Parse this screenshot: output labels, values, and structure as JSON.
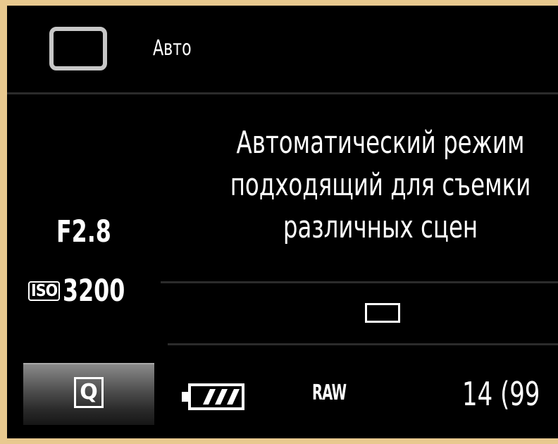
{
  "mode": {
    "icon": "square-mode-icon",
    "label": "Авто"
  },
  "description": {
    "line1": "Автоматический режим",
    "line2": "подходящий для съемки",
    "line3": "различных сцен"
  },
  "exposure": {
    "aperture": "F2.8",
    "iso_icon_text": "ISO",
    "iso_value": "3200"
  },
  "drive": {
    "icon": "single-shot-icon"
  },
  "bottom_bar": {
    "quick_button_label": "Q",
    "battery_icon": "battery-full-icon",
    "battery_level": 1.0,
    "image_quality": "RAW",
    "shots_remaining": "14 (99"
  },
  "colors": {
    "background": "#000000",
    "text": "#ffffff",
    "frame": "#e8c98f",
    "mode_box": "#c7c7c7"
  }
}
